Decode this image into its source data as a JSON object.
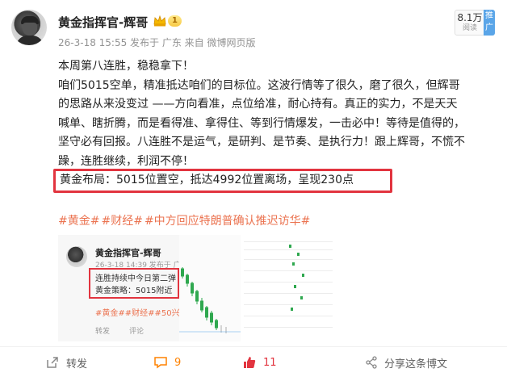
{
  "post": {
    "author": "黄金指挥官-辉哥",
    "level_badge": "1",
    "meta": "26-3-18 15:55 发布于 广东 来自 微博网页版",
    "reads": {
      "count": "8.1万",
      "label": "阅读"
    },
    "promo_label": "推广",
    "lines": [
      "本周第八连胜，稳稳拿下！",
      "咱们5015空单，精准抵达咱们的目标位。这波行情等了很久，磨了很久，但辉哥",
      "的思路从来没变过 ——方向看准，点位给准，耐心持有。真正的实力，不是天天",
      "喊单、瞎折腾，而是看得准、拿得住、等到行情爆发，一击必中！等待是值得的，",
      "坚守必有回报。八连胜不是运气，是研判、是节奏、是执行力！跟上辉哥，不慌不",
      "躁，连胜继续，利润不停！"
    ],
    "highlight": "黄金布局：5015位置空，抵达4992位置离场，呈现230点",
    "tags": [
      "#黄金#",
      "#财经#",
      "#中方回应特朗普确认推迟访华#"
    ]
  },
  "embedded": {
    "author": "黄金指挥官-辉哥",
    "meta": "26-3-18 14:39 发布于 广",
    "line1": "连胜持续中今日第二弹",
    "line2": "黄金策略：5015附近",
    "tags": "#黄金##财经##50兴",
    "actions": [
      "转发",
      "评论"
    ]
  },
  "actions": {
    "repost": "转发",
    "comments": "9",
    "likes": "11",
    "share": "分享这条博文"
  },
  "colors": {
    "accent": "#eb7350",
    "highlight_border": "#e2343f",
    "like": "#e2343f",
    "comment": "#ff8200"
  }
}
